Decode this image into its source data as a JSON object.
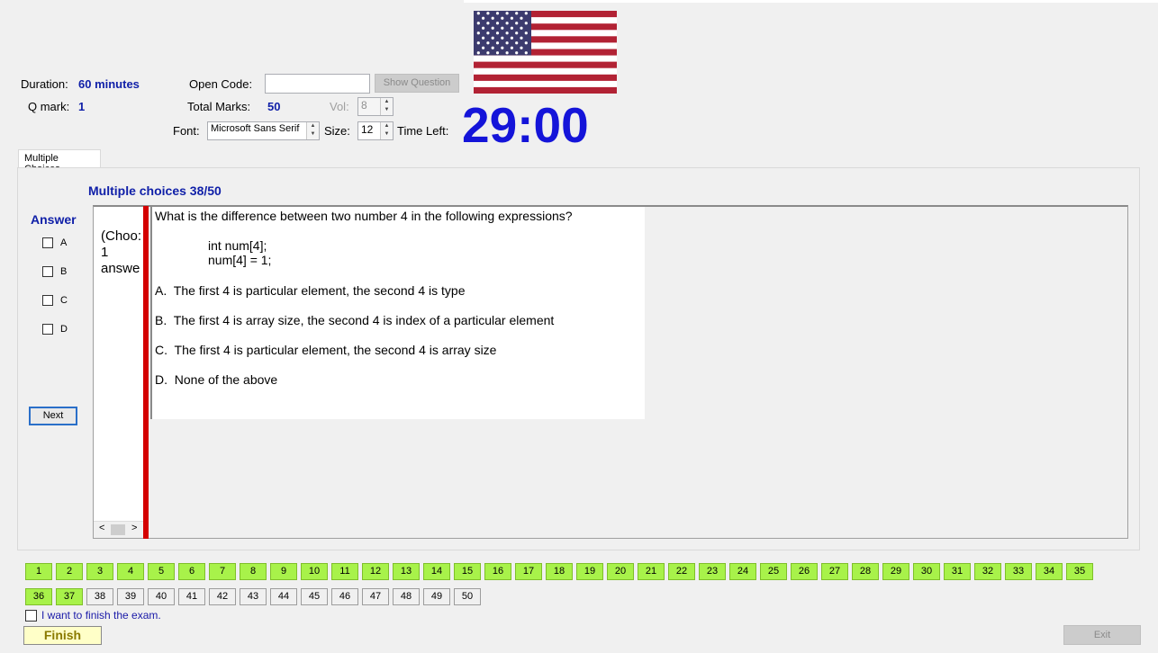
{
  "header": {
    "duration_label": "Duration:",
    "duration_value": "60 minutes",
    "qmark_label": "Q mark:",
    "qmark_value": "1",
    "open_code_label": "Open Code:",
    "open_code_value": "",
    "show_question_label": "Show Question",
    "total_marks_label": "Total Marks:",
    "total_marks_value": "50",
    "vol_label": "Vol:",
    "vol_value": "8",
    "font_label": "Font:",
    "font_value": "Microsoft Sans Serif",
    "size_label": "Size:",
    "size_value": "12",
    "time_left_label": "Time Left:",
    "timer": "29:00",
    "flag_icon": "us-flag-icon"
  },
  "tab": {
    "label": "Multiple Choices"
  },
  "section_title": "Multiple choices 38/50",
  "answer": {
    "heading": "Answer",
    "options": [
      "A",
      "B",
      "C",
      "D"
    ],
    "next_label": "Next"
  },
  "hint": {
    "line1": "(Choo:",
    "line2": "1",
    "line3": "answe"
  },
  "question": {
    "prompt": "What is the difference between two number 4 in the following expressions?",
    "code_line1": "int num[4];",
    "code_line2": "num[4] = 1;",
    "choices": [
      {
        "letter": "A.",
        "text": "The first 4 is particular element, the second 4 is type"
      },
      {
        "letter": "B.",
        "text": "The first 4 is array size, the second 4 is index of a particular element"
      },
      {
        "letter": "C.",
        "text": "The first 4 is particular element, the second 4 is array size"
      },
      {
        "letter": "D.",
        "text": "None of the above"
      }
    ]
  },
  "navigator": {
    "row1": [
      "1",
      "2",
      "3",
      "4",
      "5",
      "6",
      "7",
      "8",
      "9",
      "10",
      "11",
      "12",
      "13",
      "14",
      "15",
      "16",
      "17",
      "18",
      "19",
      "20",
      "21",
      "22",
      "23",
      "24",
      "25",
      "26",
      "27",
      "28",
      "29",
      "30",
      "31",
      "32",
      "33",
      "34",
      "35"
    ],
    "row2": [
      "36",
      "37",
      "38",
      "39",
      "40",
      "41",
      "42",
      "43",
      "44",
      "45",
      "46",
      "47",
      "48",
      "49",
      "50"
    ],
    "answered_through": 37
  },
  "footer": {
    "finish_check_label": "I want to finish the exam.",
    "finish_label": "Finish",
    "exit_label": "Exit"
  },
  "colors": {
    "timer": "#1414d9",
    "answered": "#a8f24a",
    "divider": "#d40000",
    "finish_bg": "#ffffc8"
  }
}
